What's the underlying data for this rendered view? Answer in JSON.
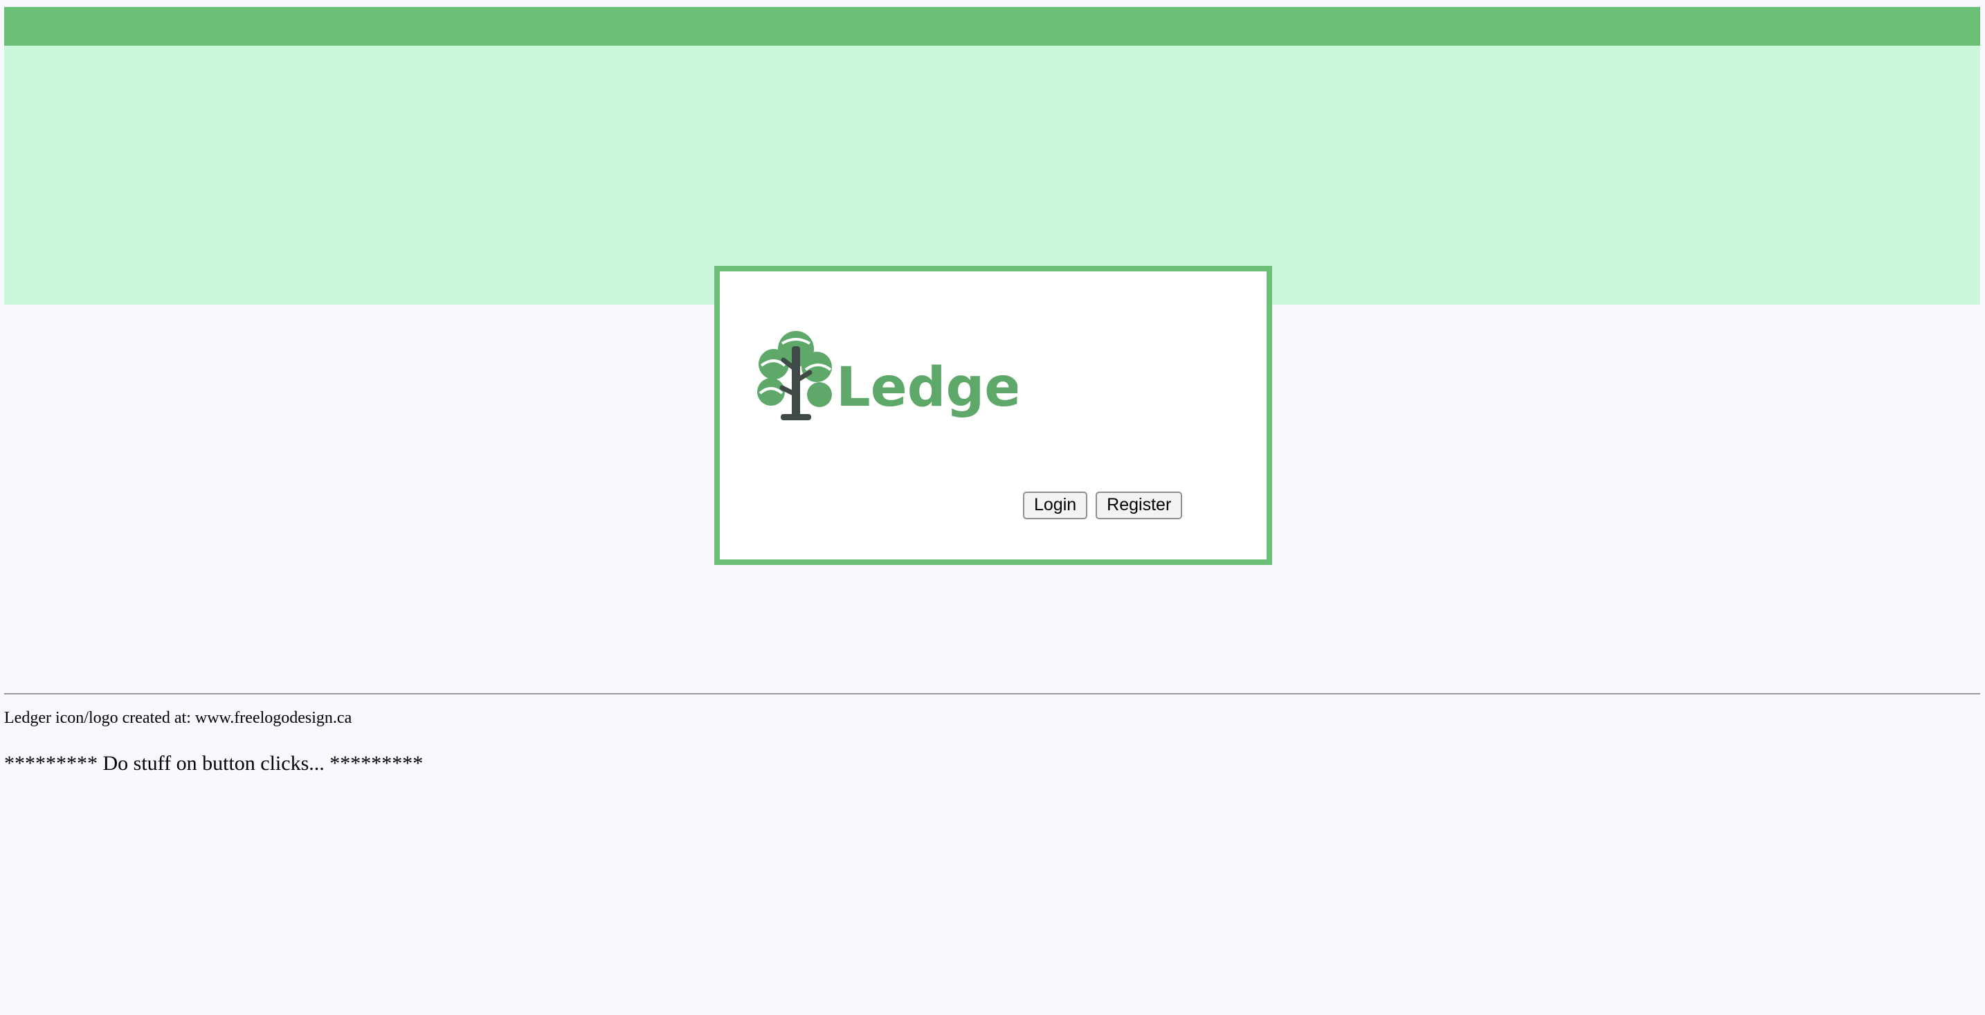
{
  "header": {
    "bar_color": "#6dbe77",
    "band_color": "#cbf7db"
  },
  "login_card": {
    "border_color": "#6dbe77",
    "logo": {
      "icon": "tree-icon",
      "text": "Ledger",
      "text_color": "#5ea86a"
    },
    "buttons": {
      "login_label": "Login",
      "register_label": "Register"
    }
  },
  "footer": {
    "credit_text": "Ledger icon/logo created at: www.freelogodesign.ca",
    "status_text": "********* Do stuff on button clicks... *********"
  }
}
